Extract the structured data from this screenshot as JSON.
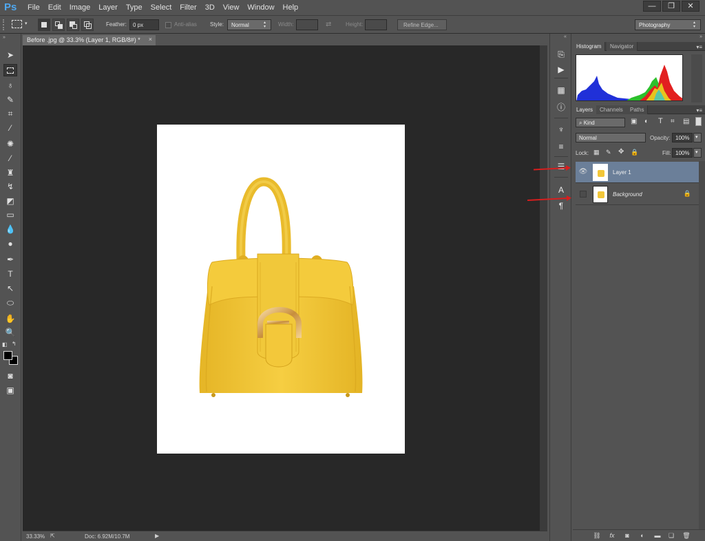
{
  "app": {
    "logo": "Ps"
  },
  "menu": [
    "File",
    "Edit",
    "Image",
    "Layer",
    "Type",
    "Select",
    "Filter",
    "3D",
    "View",
    "Window",
    "Help"
  ],
  "window_controls": {
    "minimize": "—",
    "restore": "❐",
    "close": "✕"
  },
  "options": {
    "feather_label": "Feather:",
    "feather_value": "0 px",
    "antialias_label": "Anti-alias",
    "style_label": "Style:",
    "style_value": "Normal",
    "width_label": "Width:",
    "height_label": "Height:",
    "refine_edge": "Refine Edge...",
    "workspace": "Photography"
  },
  "document": {
    "tab_title": "Before .jpg @ 33.3% (Layer 1, RGB/8#) *",
    "tab_close": "×",
    "zoom": "33.33%",
    "doc_info": "Doc: 6.92M/10.7M"
  },
  "panels": {
    "top_tabs": [
      "Histogram",
      "Navigator"
    ],
    "layer_tabs": [
      "Layers",
      "Channels",
      "Paths"
    ],
    "kind": "Kind",
    "blend_mode": "Normal",
    "opacity_label": "Opacity:",
    "opacity_value": "100%",
    "lock_label": "Lock:",
    "fill_label": "Fill:",
    "fill_value": "100%",
    "layers": [
      {
        "name": "Layer 1",
        "visible": true,
        "selected": true
      },
      {
        "name": "Background",
        "visible": false,
        "selected": false,
        "locked": true
      }
    ]
  },
  "colors": {
    "canvas_bg": "#282828",
    "panel_bg": "#535353",
    "selected_layer": "#6b7f99",
    "bag_yellow": "#f2c73a",
    "annotation_arrow": "#d81e1e"
  }
}
